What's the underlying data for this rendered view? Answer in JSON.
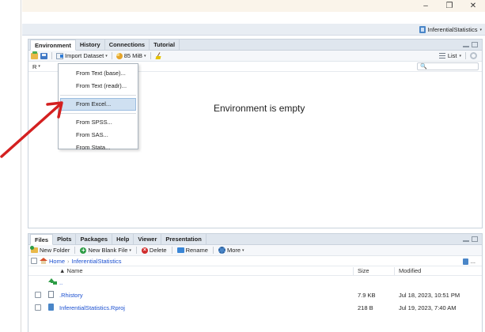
{
  "window": {
    "controls": {
      "minimize": "–",
      "restore": "❐",
      "close": "✕"
    }
  },
  "project_bar": {
    "project_name": "InferentialStatistics",
    "caret": "▾"
  },
  "env_pane": {
    "tabs": [
      "Environment",
      "History",
      "Connections",
      "Tutorial"
    ],
    "active_tab": "Environment",
    "toolbar": {
      "import_label": "Import Dataset",
      "memory_label": "85 MiB",
      "list_label": "List",
      "caret": "▾"
    },
    "toolbar2": {
      "lang_label": "R",
      "search_placeholder": "🔍"
    },
    "empty_message": "Environment is empty",
    "import_menu": {
      "items": [
        "From Text (base)...",
        "From Text (readr)...",
        "From Excel...",
        "From SPSS...",
        "From SAS...",
        "From Stata..."
      ],
      "selected": "From Excel..."
    }
  },
  "files_pane": {
    "tabs": [
      "Files",
      "Plots",
      "Packages",
      "Help",
      "Viewer",
      "Presentation"
    ],
    "active_tab": "Files",
    "toolbar": {
      "new_folder": "New Folder",
      "new_blank_file": "New Blank File",
      "delete": "Delete",
      "rename": "Rename",
      "more": "More",
      "caret": "▾"
    },
    "breadcrumb": {
      "home": "Home",
      "separator": "›",
      "folder": "InferentialStatistics",
      "ellipsis": "..."
    },
    "columns": {
      "name": "Name",
      "size": "Size",
      "modified": "Modified",
      "sort_indicator": "▲"
    },
    "rows": [
      {
        "name": "..",
        "size": "",
        "modified": "",
        "icon": "up-arrow-icon"
      },
      {
        "name": ".Rhistory",
        "size": "7.9 KB",
        "modified": "Jul 18, 2023, 10:51 PM",
        "icon": "file-icon"
      },
      {
        "name": "InferentialStatistics.Rproj",
        "size": "218 B",
        "modified": "Jul 19, 2023, 7:40 AM",
        "icon": "rproj-icon"
      }
    ]
  },
  "colors": {
    "accent_link": "#1a4fd0",
    "menu_selected": "#cfe0f1",
    "arrow_red": "#d42020",
    "title_bar": "#faf4ea"
  }
}
